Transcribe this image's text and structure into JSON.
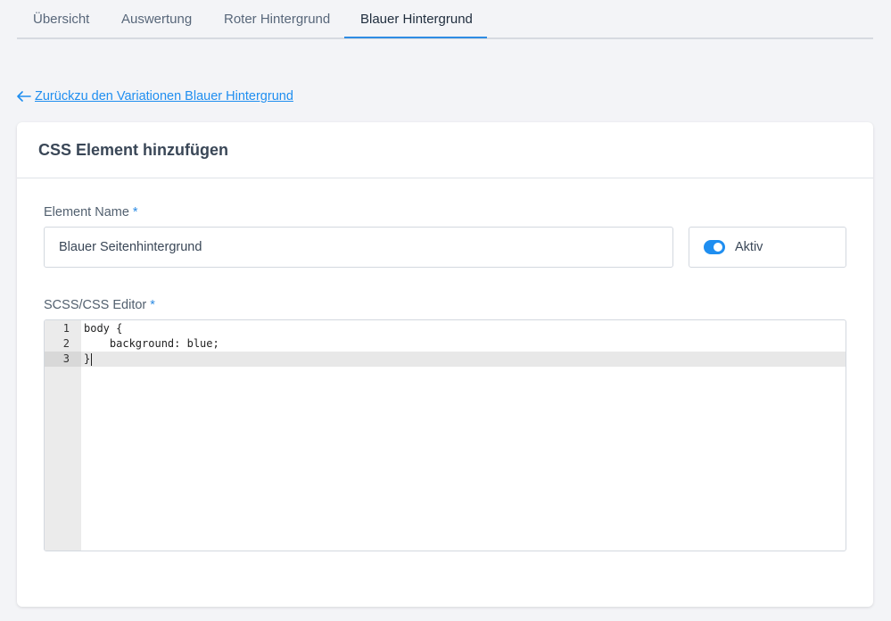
{
  "tabs": [
    {
      "label": "Übersicht"
    },
    {
      "label": "Auswertung"
    },
    {
      "label": "Roter Hintergrund"
    },
    {
      "label": "Blauer Hintergrund"
    }
  ],
  "active_tab": "Blauer Hintergrund",
  "back_link": {
    "label": "Zurückzu den Variationen Blauer Hintergrund",
    "icon": "arrow-left-icon"
  },
  "card": {
    "title": "CSS Element hinzufügen",
    "name_field": {
      "label": "Element Name",
      "required_mark": "*",
      "value": "Blauer Seitenhintergrund"
    },
    "active_toggle": {
      "label": "Aktiv",
      "checked": true
    },
    "editor": {
      "label": "SCSS/CSS Editor",
      "required_mark": "*",
      "lines": [
        {
          "number": "1",
          "text": "body {"
        },
        {
          "number": "2",
          "text": "    background: blue;"
        },
        {
          "number": "3",
          "text": "}"
        }
      ],
      "active_line": 3
    }
  },
  "colors": {
    "accent": "#1f8ef0",
    "background": "#f3f4f7"
  }
}
